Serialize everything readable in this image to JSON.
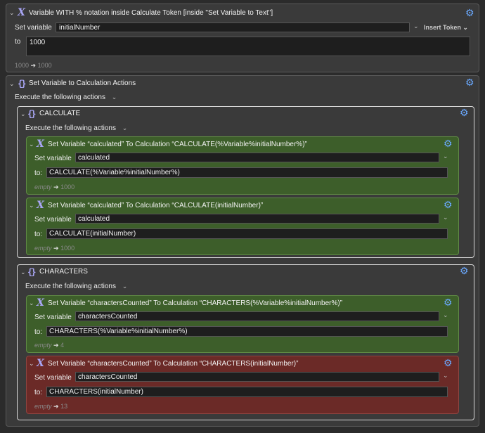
{
  "top": {
    "title": "Variable WITH % notation inside Calculate Token [inside \"Set Variable to Text\"]",
    "set_variable_label": "Set variable",
    "variable_value": "initialNumber",
    "insert_token_label": "Insert Token",
    "to_label": "to",
    "to_value": "1000",
    "result_from": "1000",
    "result_to": "1000"
  },
  "calc_actions": {
    "title": "Set Variable to Calculation Actions",
    "execute_label": "Execute the following actions"
  },
  "calculate_group": {
    "title": "CALCULATE",
    "execute_label": "Execute the following actions",
    "actions": [
      {
        "title": "Set Variable “calculated” To Calculation “CALCULATE(%Variable%initialNumber%)”",
        "set_variable_label": "Set variable",
        "variable": "calculated",
        "to_label": "to:",
        "expression": "CALCULATE(%Variable%initialNumber%)",
        "result_empty": "empty",
        "result": "1000"
      },
      {
        "title": "Set Variable “calculated” To Calculation “CALCULATE(initialNumber)”",
        "set_variable_label": "Set variable",
        "variable": "calculated",
        "to_label": "to:",
        "expression": "CALCULATE(initialNumber)",
        "result_empty": "empty",
        "result": "1000"
      }
    ]
  },
  "characters_group": {
    "title": "CHARACTERS",
    "execute_label": "Execute the following actions",
    "actions": [
      {
        "title": "Set Variable “charactersCounted” To Calculation “CHARACTERS(%Variable%initialNumber%)”",
        "set_variable_label": "Set variable",
        "variable": "charactersCounted",
        "to_label": "to:",
        "expression": "CHARACTERS(%Variable%initialNumber%)",
        "result_empty": "empty",
        "result": "4"
      },
      {
        "title": "Set Variable “charactersCounted” To Calculation “CHARACTERS(initialNumber)”",
        "set_variable_label": "Set variable",
        "variable": "charactersCounted",
        "to_label": "to:",
        "expression": "CHARACTERS(initialNumber)",
        "result_empty": "empty",
        "result": "13"
      }
    ]
  },
  "icons": {
    "variable": "variable-x-icon",
    "calculation": "braces-icon",
    "gear": "gear-icon",
    "disclosure": "chevron-down-icon"
  },
  "colors": {
    "green_action": "#3d5e2a",
    "red_action": "#6b2a27",
    "gear": "#6aa9ff",
    "icon": "#a9a6f5"
  }
}
